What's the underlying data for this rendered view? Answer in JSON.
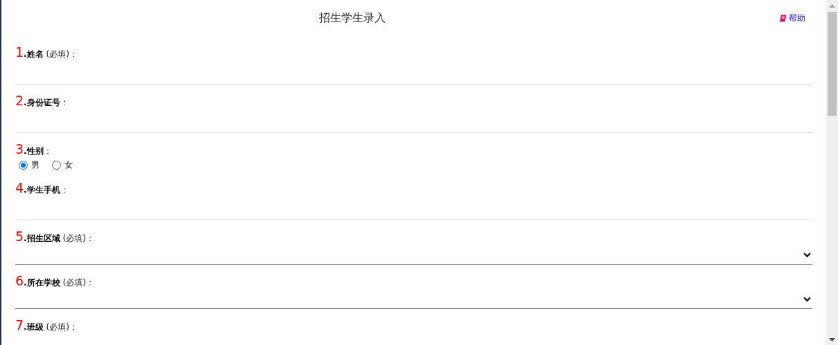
{
  "header": {
    "title": "招生学生录入",
    "help_link": "帮助"
  },
  "fields": [
    {
      "number": "1",
      "label": "**.姓名** (必填)：",
      "kind": "text"
    },
    {
      "number": "2",
      "label": "**.身份证号**：",
      "kind": "text"
    },
    {
      "number": "3",
      "label": "**.性别**：",
      "kind": "radio",
      "options": [
        {
          "label": "男",
          "selected": true
        },
        {
          "label": "女",
          "selected": false
        }
      ]
    },
    {
      "number": "4",
      "label": "**.学生手机**：",
      "kind": "text"
    },
    {
      "number": "5",
      "label": "**.招生区域** (必填)：",
      "kind": "select"
    },
    {
      "number": "6",
      "label": "**.所在学校** (必填)：",
      "kind": "select"
    },
    {
      "number": "7",
      "label": "**.班级** (必填)：",
      "kind": "label_only"
    }
  ]
}
